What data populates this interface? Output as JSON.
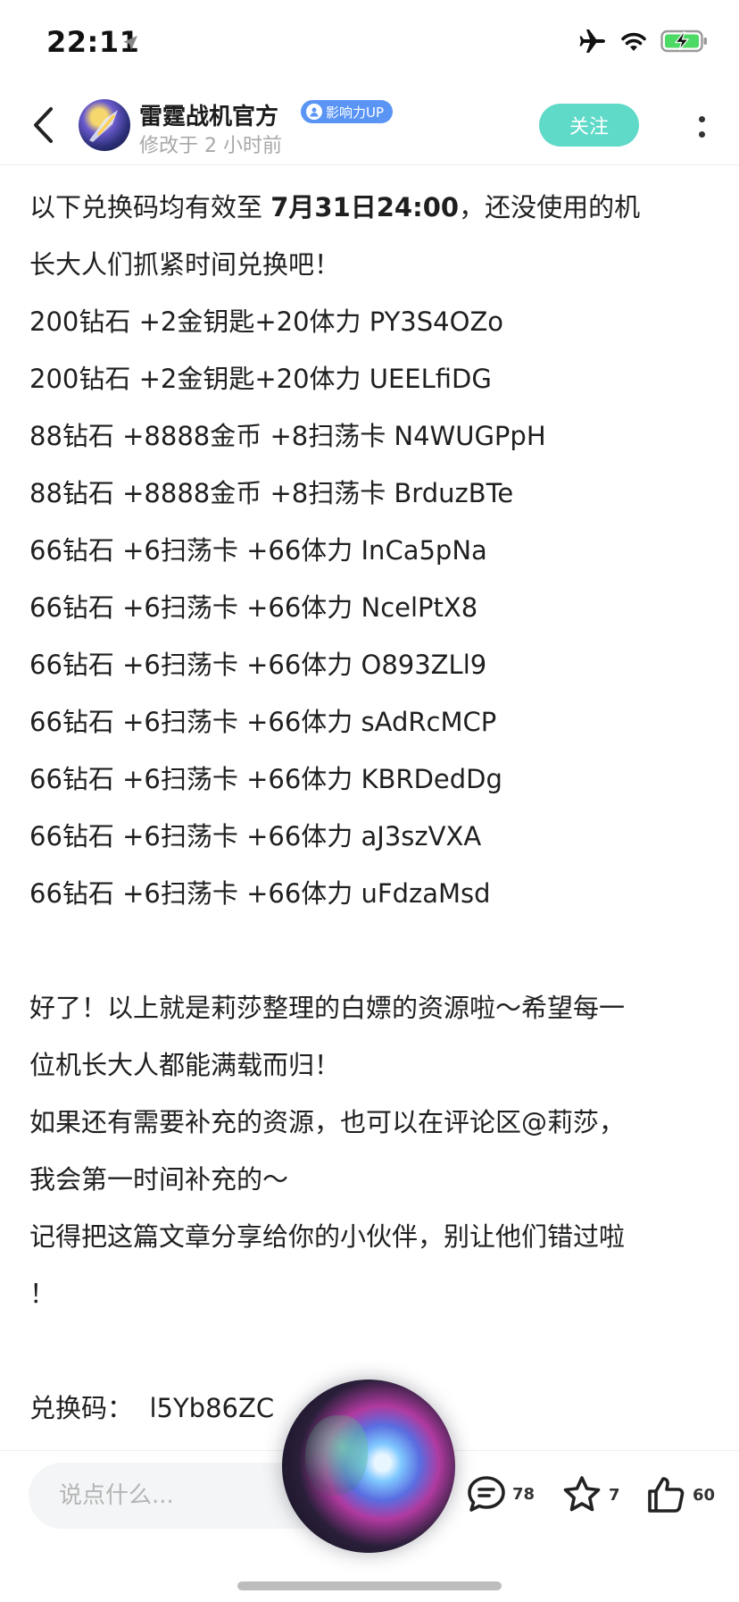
{
  "status": {
    "time": "22:11",
    "icons": [
      "location-arrow-icon",
      "airplane-icon",
      "wifi-icon",
      "battery-charging-icon"
    ],
    "battery_color": "#4cd964"
  },
  "header": {
    "author": "雷霆战机官方",
    "badge": "影响力UP",
    "modified": "修改于 2 小时前",
    "follow_label": "关注",
    "follow_color": "#5fd9c8",
    "badge_color": "#5a95f5"
  },
  "article": {
    "intro_pre": "以下兑换码均有效至 ",
    "intro_bold": "7月31日24:00",
    "intro_post": "，还没使用的机",
    "intro_line2": "长大人们抓紧时间兑换吧！",
    "codes": [
      "200钻石 +2金钥匙+20体力 PY3S4OZo",
      "200钻石 +2金钥匙+20体力 UEELfiDG",
      "88钻石 +8888金币 +8扫荡卡 N4WUGPpH",
      "88钻石 +8888金币 +8扫荡卡 BrduzBTe",
      "66钻石 +6扫荡卡 +66体力 InCa5pNa",
      "66钻石 +6扫荡卡 +66体力 NcelPtX8",
      "66钻石 +6扫荡卡 +66体力 O893ZLl9",
      "66钻石 +6扫荡卡 +66体力 sAdRcMCP",
      "66钻石 +6扫荡卡 +66体力 KBRDedDg",
      "66钻石 +6扫荡卡 +66体力 aJ3szVXA",
      "66钻石 +6扫荡卡 +66体力 uFdzaMsd"
    ],
    "outro": [
      "好了！以上就是莉莎整理的白嫖的资源啦～希望每一",
      "位机长大人都能满载而归！",
      "如果还有需要补充的资源，也可以在评论区@莉莎，",
      "我会第一时间补充的～",
      "记得把这篇文章分享给你的小伙伴，别让他们错过啦",
      "！"
    ],
    "redeem_label": "兑换码：",
    "redeem_code": "l5Yb86ZC"
  },
  "bottom": {
    "comment_placeholder": "说点什么...",
    "comments_count": "78",
    "favorites_count": "7",
    "likes_count": "60"
  }
}
